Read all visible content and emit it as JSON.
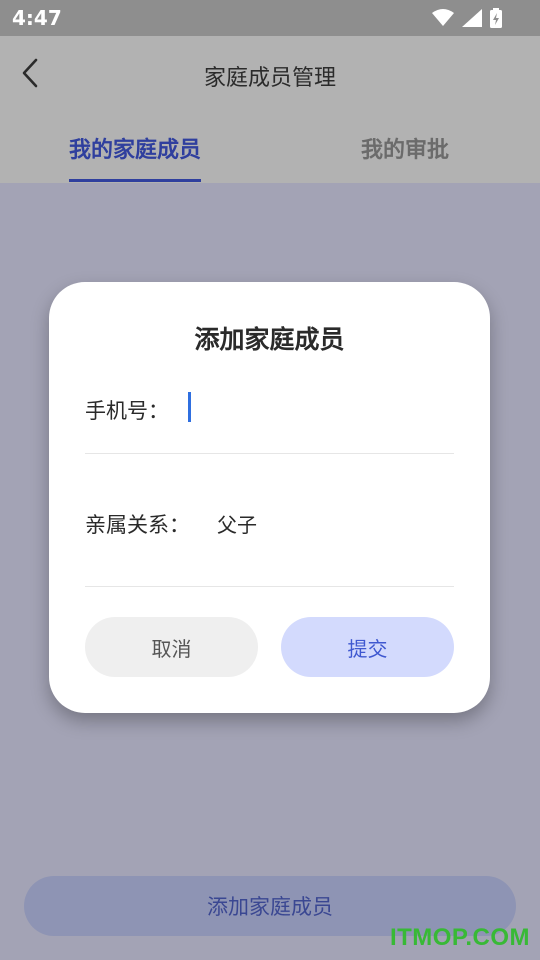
{
  "status_bar": {
    "time": "4:47"
  },
  "header": {
    "title": "家庭成员管理"
  },
  "tabs": [
    {
      "label": "我的家庭成员",
      "active": true
    },
    {
      "label": "我的审批",
      "active": false
    }
  ],
  "dialog": {
    "title": "添加家庭成员",
    "phone_label": "手机号：",
    "phone_value": "",
    "relation_label": "亲属关系：",
    "relation_value": "父子",
    "cancel_label": "取消",
    "submit_label": "提交"
  },
  "bottom": {
    "add_button_label": "添加家庭成员"
  },
  "watermark": "ITMOP.COM",
  "colors": {
    "accent": "#2f3f9e",
    "submit_bg": "#d3dafd",
    "submit_text": "#3f58d0",
    "cursor": "#2f6fe0",
    "watermark": "#38b936"
  }
}
